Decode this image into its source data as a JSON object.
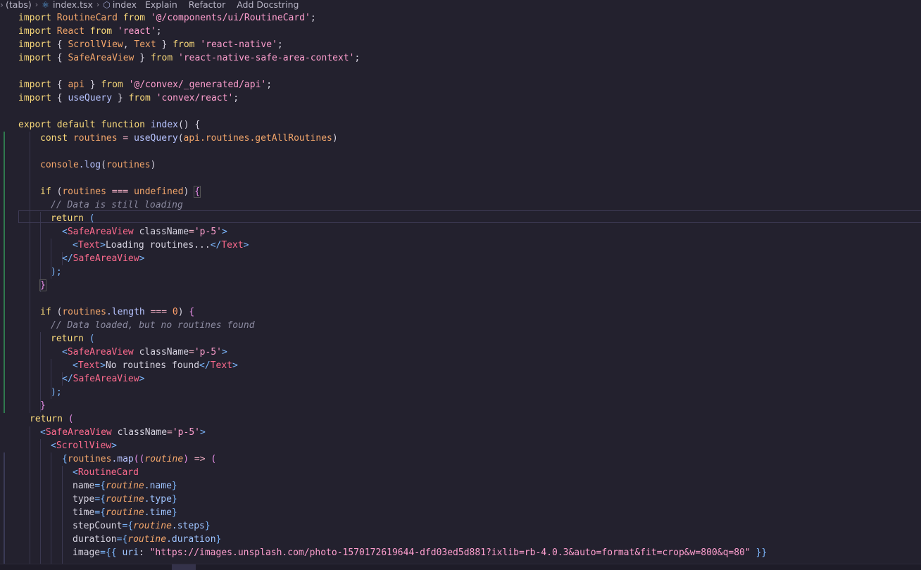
{
  "breadcrumb": {
    "folder": "(tabs)",
    "file": "index.tsx",
    "symbol": "index",
    "actions": [
      "Explain",
      "Refactor",
      "Add Docstring"
    ]
  },
  "colors": {
    "background": "#23212e",
    "keyword": "#f8d87a",
    "identifier": "#f3a66b",
    "string": "#ff9fcf",
    "tag": "#ff6b8e",
    "comment": "#8b8aa0"
  },
  "code": {
    "l1": {
      "a": "import",
      "b": "RoutineCard",
      "c": "from",
      "d": "'@/components/ui/RoutineCard'",
      "e": ";"
    },
    "l2": {
      "a": "import",
      "b": "React",
      "c": "from",
      "d": "'react'",
      "e": ";"
    },
    "l3": {
      "a": "import",
      "b": "{",
      "c": "ScrollView",
      "d": ",",
      "e": "Text",
      "f": "}",
      "g": "from",
      "h": "'react-native'",
      "i": ";"
    },
    "l4": {
      "a": "import",
      "b": "{",
      "c": "SafeAreaView",
      "d": "}",
      "e": "from",
      "f": "'react-native-safe-area-context'",
      "g": ";"
    },
    "l6": {
      "a": "import",
      "b": "{",
      "c": "api",
      "d": "}",
      "e": "from",
      "f": "'@/convex/_generated/api'",
      "g": ";"
    },
    "l7": {
      "a": "import",
      "b": "{",
      "c": "useQuery",
      "d": "}",
      "e": "from",
      "f": "'convex/react'",
      "g": ";"
    },
    "l9": {
      "a": "export default function",
      "b": "index",
      "c": "()",
      "d": "{"
    },
    "l10": {
      "a": "const",
      "b": "routines",
      "c": "=",
      "d": "useQuery",
      "e": "(",
      "f": "api.routines.getAllRoutines",
      "g": ")"
    },
    "l12": {
      "a": "console",
      "b": ".log",
      "c": "(",
      "d": "routines",
      "e": ")"
    },
    "l14": {
      "a": "if",
      "b": "(",
      "c": "routines",
      "d": "===",
      "e": "undefined",
      "f": ")",
      "g": "{"
    },
    "l15": {
      "a": "// Data is still loading"
    },
    "l16": {
      "a": "return",
      "b": "("
    },
    "l17": {
      "a": "<",
      "b": "SafeAreaView",
      "c": "className",
      "d": "=",
      "e": "'p-5'",
      "f": ">"
    },
    "l18": {
      "a": "<",
      "b": "Text",
      "c": ">",
      "d": "Loading routines...",
      "e": "</",
      "f": "Text",
      "g": ">"
    },
    "l19": {
      "a": "</",
      "b": "SafeAreaView",
      "c": ">"
    },
    "l20": {
      "a": ");"
    },
    "l21": {
      "a": "}"
    },
    "l23": {
      "a": "if",
      "b": "(",
      "c": "routines",
      "d": ".length",
      "e": "===",
      "f": "0",
      "g": ")",
      "h": "{"
    },
    "l24": {
      "a": "// Data loaded, but no routines found"
    },
    "l25": {
      "a": "return",
      "b": "("
    },
    "l26": {
      "a": "<",
      "b": "SafeAreaView",
      "c": "className",
      "d": "=",
      "e": "'p-5'",
      "f": ">"
    },
    "l27": {
      "a": "<",
      "b": "Text",
      "c": ">",
      "d": "No routines found",
      "e": "</",
      "f": "Text",
      "g": ">"
    },
    "l28": {
      "a": "</",
      "b": "SafeAreaView",
      "c": ">"
    },
    "l29": {
      "a": ");"
    },
    "l30": {
      "a": "}"
    },
    "l31": {
      "a": "return",
      "b": "("
    },
    "l32": {
      "a": "<",
      "b": "SafeAreaView",
      "c": "className",
      "d": "=",
      "e": "'p-5'",
      "f": ">"
    },
    "l33": {
      "a": "<",
      "b": "ScrollView",
      "c": ">"
    },
    "l34": {
      "a": "{",
      "b": "routines",
      "c": ".map",
      "d": "((",
      "e": "routine",
      "f": ")",
      "g": "=>",
      "h": "("
    },
    "l35": {
      "a": "<",
      "b": "RoutineCard"
    },
    "l36": {
      "a": "name",
      "b": "={",
      "c": "routine",
      "d": ".name",
      "e": "}"
    },
    "l37": {
      "a": "type",
      "b": "={",
      "c": "routine",
      "d": ".type",
      "e": "}"
    },
    "l38": {
      "a": "time",
      "b": "={",
      "c": "routine",
      "d": ".time",
      "e": "}"
    },
    "l39": {
      "a": "stepCount",
      "b": "={",
      "c": "routine",
      "d": ".steps",
      "e": "}"
    },
    "l40": {
      "a": "duration",
      "b": "={",
      "c": "routine",
      "d": ".duration",
      "e": "}"
    },
    "l41": {
      "a": "image",
      "b": "={{",
      "c": "uri",
      "d": ":",
      "e": "\"https://images.unsplash.com/photo-1570172619644-dfd03ed5d881?ixlib=rb-4.0.3&auto=format&fit=crop&w=800&q=80\"",
      "f": "}}"
    }
  }
}
